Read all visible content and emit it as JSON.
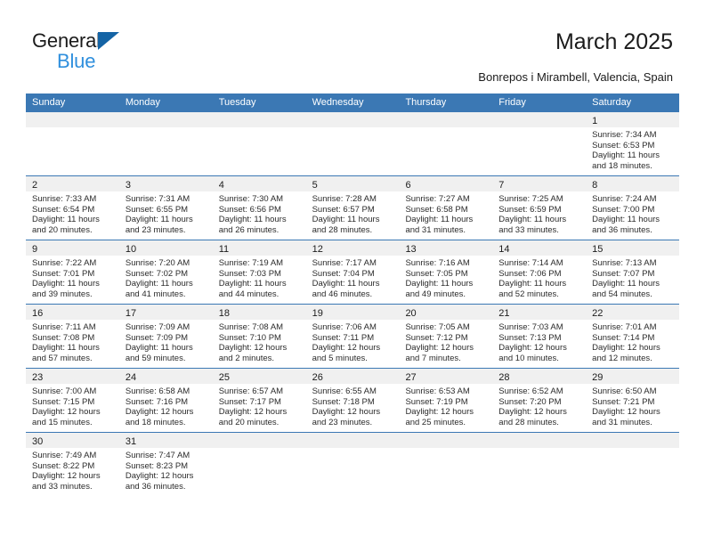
{
  "brand": {
    "name_part1": "General",
    "name_part2": "Blue",
    "accent_color": "#1464a5",
    "secondary_color": "#2f8fdd"
  },
  "header": {
    "title": "March 2025",
    "subtitle": "Bonrepos i Mirambell, Valencia, Spain"
  },
  "calendar": {
    "header_color": "#3b78b4",
    "day_band_color": "#f0f0f0",
    "weekday_names": [
      "Sunday",
      "Monday",
      "Tuesday",
      "Wednesday",
      "Thursday",
      "Friday",
      "Saturday"
    ],
    "weeks": [
      [
        {
          "day": "",
          "lines": []
        },
        {
          "day": "",
          "lines": []
        },
        {
          "day": "",
          "lines": []
        },
        {
          "day": "",
          "lines": []
        },
        {
          "day": "",
          "lines": []
        },
        {
          "day": "",
          "lines": []
        },
        {
          "day": "1",
          "lines": [
            "Sunrise: 7:34 AM",
            "Sunset: 6:53 PM",
            "Daylight: 11 hours",
            "and 18 minutes."
          ]
        }
      ],
      [
        {
          "day": "2",
          "lines": [
            "Sunrise: 7:33 AM",
            "Sunset: 6:54 PM",
            "Daylight: 11 hours",
            "and 20 minutes."
          ]
        },
        {
          "day": "3",
          "lines": [
            "Sunrise: 7:31 AM",
            "Sunset: 6:55 PM",
            "Daylight: 11 hours",
            "and 23 minutes."
          ]
        },
        {
          "day": "4",
          "lines": [
            "Sunrise: 7:30 AM",
            "Sunset: 6:56 PM",
            "Daylight: 11 hours",
            "and 26 minutes."
          ]
        },
        {
          "day": "5",
          "lines": [
            "Sunrise: 7:28 AM",
            "Sunset: 6:57 PM",
            "Daylight: 11 hours",
            "and 28 minutes."
          ]
        },
        {
          "day": "6",
          "lines": [
            "Sunrise: 7:27 AM",
            "Sunset: 6:58 PM",
            "Daylight: 11 hours",
            "and 31 minutes."
          ]
        },
        {
          "day": "7",
          "lines": [
            "Sunrise: 7:25 AM",
            "Sunset: 6:59 PM",
            "Daylight: 11 hours",
            "and 33 minutes."
          ]
        },
        {
          "day": "8",
          "lines": [
            "Sunrise: 7:24 AM",
            "Sunset: 7:00 PM",
            "Daylight: 11 hours",
            "and 36 minutes."
          ]
        }
      ],
      [
        {
          "day": "9",
          "lines": [
            "Sunrise: 7:22 AM",
            "Sunset: 7:01 PM",
            "Daylight: 11 hours",
            "and 39 minutes."
          ]
        },
        {
          "day": "10",
          "lines": [
            "Sunrise: 7:20 AM",
            "Sunset: 7:02 PM",
            "Daylight: 11 hours",
            "and 41 minutes."
          ]
        },
        {
          "day": "11",
          "lines": [
            "Sunrise: 7:19 AM",
            "Sunset: 7:03 PM",
            "Daylight: 11 hours",
            "and 44 minutes."
          ]
        },
        {
          "day": "12",
          "lines": [
            "Sunrise: 7:17 AM",
            "Sunset: 7:04 PM",
            "Daylight: 11 hours",
            "and 46 minutes."
          ]
        },
        {
          "day": "13",
          "lines": [
            "Sunrise: 7:16 AM",
            "Sunset: 7:05 PM",
            "Daylight: 11 hours",
            "and 49 minutes."
          ]
        },
        {
          "day": "14",
          "lines": [
            "Sunrise: 7:14 AM",
            "Sunset: 7:06 PM",
            "Daylight: 11 hours",
            "and 52 minutes."
          ]
        },
        {
          "day": "15",
          "lines": [
            "Sunrise: 7:13 AM",
            "Sunset: 7:07 PM",
            "Daylight: 11 hours",
            "and 54 minutes."
          ]
        }
      ],
      [
        {
          "day": "16",
          "lines": [
            "Sunrise: 7:11 AM",
            "Sunset: 7:08 PM",
            "Daylight: 11 hours",
            "and 57 minutes."
          ]
        },
        {
          "day": "17",
          "lines": [
            "Sunrise: 7:09 AM",
            "Sunset: 7:09 PM",
            "Daylight: 11 hours",
            "and 59 minutes."
          ]
        },
        {
          "day": "18",
          "lines": [
            "Sunrise: 7:08 AM",
            "Sunset: 7:10 PM",
            "Daylight: 12 hours",
            "and 2 minutes."
          ]
        },
        {
          "day": "19",
          "lines": [
            "Sunrise: 7:06 AM",
            "Sunset: 7:11 PM",
            "Daylight: 12 hours",
            "and 5 minutes."
          ]
        },
        {
          "day": "20",
          "lines": [
            "Sunrise: 7:05 AM",
            "Sunset: 7:12 PM",
            "Daylight: 12 hours",
            "and 7 minutes."
          ]
        },
        {
          "day": "21",
          "lines": [
            "Sunrise: 7:03 AM",
            "Sunset: 7:13 PM",
            "Daylight: 12 hours",
            "and 10 minutes."
          ]
        },
        {
          "day": "22",
          "lines": [
            "Sunrise: 7:01 AM",
            "Sunset: 7:14 PM",
            "Daylight: 12 hours",
            "and 12 minutes."
          ]
        }
      ],
      [
        {
          "day": "23",
          "lines": [
            "Sunrise: 7:00 AM",
            "Sunset: 7:15 PM",
            "Daylight: 12 hours",
            "and 15 minutes."
          ]
        },
        {
          "day": "24",
          "lines": [
            "Sunrise: 6:58 AM",
            "Sunset: 7:16 PM",
            "Daylight: 12 hours",
            "and 18 minutes."
          ]
        },
        {
          "day": "25",
          "lines": [
            "Sunrise: 6:57 AM",
            "Sunset: 7:17 PM",
            "Daylight: 12 hours",
            "and 20 minutes."
          ]
        },
        {
          "day": "26",
          "lines": [
            "Sunrise: 6:55 AM",
            "Sunset: 7:18 PM",
            "Daylight: 12 hours",
            "and 23 minutes."
          ]
        },
        {
          "day": "27",
          "lines": [
            "Sunrise: 6:53 AM",
            "Sunset: 7:19 PM",
            "Daylight: 12 hours",
            "and 25 minutes."
          ]
        },
        {
          "day": "28",
          "lines": [
            "Sunrise: 6:52 AM",
            "Sunset: 7:20 PM",
            "Daylight: 12 hours",
            "and 28 minutes."
          ]
        },
        {
          "day": "29",
          "lines": [
            "Sunrise: 6:50 AM",
            "Sunset: 7:21 PM",
            "Daylight: 12 hours",
            "and 31 minutes."
          ]
        }
      ],
      [
        {
          "day": "30",
          "lines": [
            "Sunrise: 7:49 AM",
            "Sunset: 8:22 PM",
            "Daylight: 12 hours",
            "and 33 minutes."
          ]
        },
        {
          "day": "31",
          "lines": [
            "Sunrise: 7:47 AM",
            "Sunset: 8:23 PM",
            "Daylight: 12 hours",
            "and 36 minutes."
          ]
        },
        {
          "day": "",
          "lines": []
        },
        {
          "day": "",
          "lines": []
        },
        {
          "day": "",
          "lines": []
        },
        {
          "day": "",
          "lines": []
        },
        {
          "day": "",
          "lines": []
        }
      ]
    ]
  }
}
